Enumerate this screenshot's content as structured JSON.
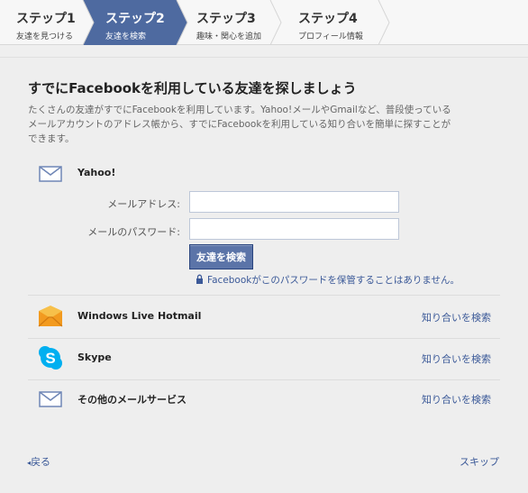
{
  "steps": [
    {
      "title": "ステップ1",
      "subtitle": "友達を見つける"
    },
    {
      "title": "ステップ2",
      "subtitle": "友達を検索"
    },
    {
      "title": "ステップ3",
      "subtitle": "趣味・関心を追加"
    },
    {
      "title": "ステップ4",
      "subtitle": "プロフィール情報"
    }
  ],
  "active_step": 2,
  "heading": "すでにFacebookを利用している友達を探しましょう",
  "description": "たくさんの友達がすでにFacebookを利用しています。Yahoo!メールやGmailなど、普段使っているメールアカウントのアドレス帳から、すでにFacebookを利用している知り合いを簡単に探すことができます。",
  "yahoo": {
    "name": "Yahoo!",
    "email_label": "メールアドレス:",
    "email_value": "",
    "password_label": "メールのパスワード:",
    "password_value": "",
    "find_button": "友達を検索",
    "privacy_note": "Facebookがこのパスワードを保管することはありません。"
  },
  "providers": [
    {
      "name": "Windows Live Hotmail",
      "action": "知り合いを検索",
      "icon": "hotmail-envelope-icon"
    },
    {
      "name": "Skype",
      "action": "知り合いを検索",
      "icon": "skype-icon"
    },
    {
      "name": "その他のメールサービス",
      "action": "知り合いを検索",
      "icon": "envelope-icon"
    }
  ],
  "footer": {
    "back": "戻る",
    "skip": "スキップ"
  },
  "colors": {
    "active_step": "#4e6aa0",
    "link": "#3b5998",
    "button": "#5b74a8"
  }
}
